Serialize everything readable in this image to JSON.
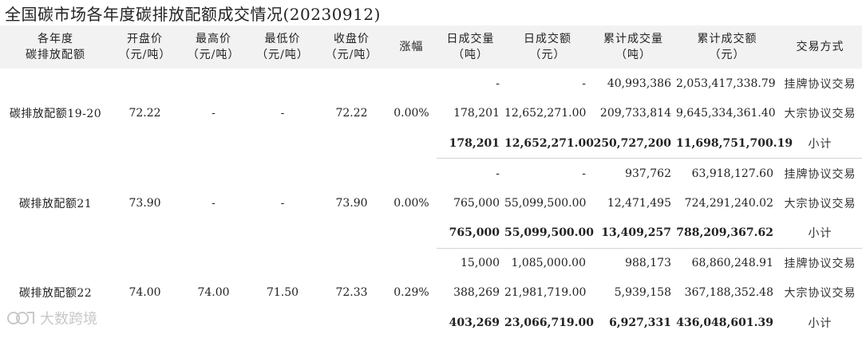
{
  "title": "全国碳市场各年度碳排放配额成交情况(20230912)",
  "headers": [
    [
      "各年度",
      "碳排放配额"
    ],
    [
      "开盘价",
      "（元/吨）"
    ],
    [
      "最高价",
      "（元/吨）"
    ],
    [
      "最低价",
      "（元/吨）"
    ],
    [
      "收盘价",
      "（元/吨）"
    ],
    [
      "涨幅"
    ],
    [
      "日成交量",
      "（吨）"
    ],
    [
      "日成交额",
      "（元）"
    ],
    [
      "累计成交量",
      "（吨）"
    ],
    [
      "累计成交额",
      "（元）"
    ],
    [
      "交易方式"
    ]
  ],
  "groups": [
    {
      "name": "碳排放配额19-20",
      "open": "72.22",
      "high": "-",
      "low": "-",
      "close": "72.22",
      "change": "0.00%",
      "rows": [
        {
          "vol": "-",
          "amt": "-",
          "cum_vol": "40,993,386",
          "cum_amt": "2,053,417,338.79",
          "type": "挂牌协议交易"
        },
        {
          "vol": "178,201",
          "amt": "12,652,271.00",
          "cum_vol": "209,733,814",
          "cum_amt": "9,645,334,361.40",
          "type": "大宗协议交易"
        },
        {
          "vol": "178,201",
          "amt": "12,652,271.00",
          "cum_vol": "250,727,200",
          "cum_amt": "11,698,751,700.19",
          "type": "小计"
        }
      ]
    },
    {
      "name": "碳排放配额21",
      "open": "73.90",
      "high": "-",
      "low": "-",
      "close": "73.90",
      "change": "0.00%",
      "rows": [
        {
          "vol": "-",
          "amt": "-",
          "cum_vol": "937,762",
          "cum_amt": "63,918,127.60",
          "type": "挂牌协议交易"
        },
        {
          "vol": "765,000",
          "amt": "55,099,500.00",
          "cum_vol": "12,471,495",
          "cum_amt": "724,291,240.02",
          "type": "大宗协议交易"
        },
        {
          "vol": "765,000",
          "amt": "55,099,500.00",
          "cum_vol": "13,409,257",
          "cum_amt": "788,209,367.62",
          "type": "小计"
        }
      ]
    },
    {
      "name": "碳排放配额22",
      "open": "74.00",
      "high": "74.00",
      "low": "71.50",
      "close": "72.33",
      "change": "0.29%",
      "rows": [
        {
          "vol": "15,000",
          "amt": "1,085,000.00",
          "cum_vol": "988,173",
          "cum_amt": "68,860,248.91",
          "type": "挂牌协议交易"
        },
        {
          "vol": "388,269",
          "amt": "21,981,719.00",
          "cum_vol": "5,939,158",
          "cum_amt": "367,188,352.48",
          "type": "大宗协议交易"
        },
        {
          "vol": "403,269",
          "amt": "23,066,719.00",
          "cum_vol": "6,927,331",
          "cum_amt": "436,048,601.39",
          "type": "小计"
        }
      ]
    }
  ],
  "watermark": "大数跨境",
  "watermark_icon": "link-logo-icon"
}
